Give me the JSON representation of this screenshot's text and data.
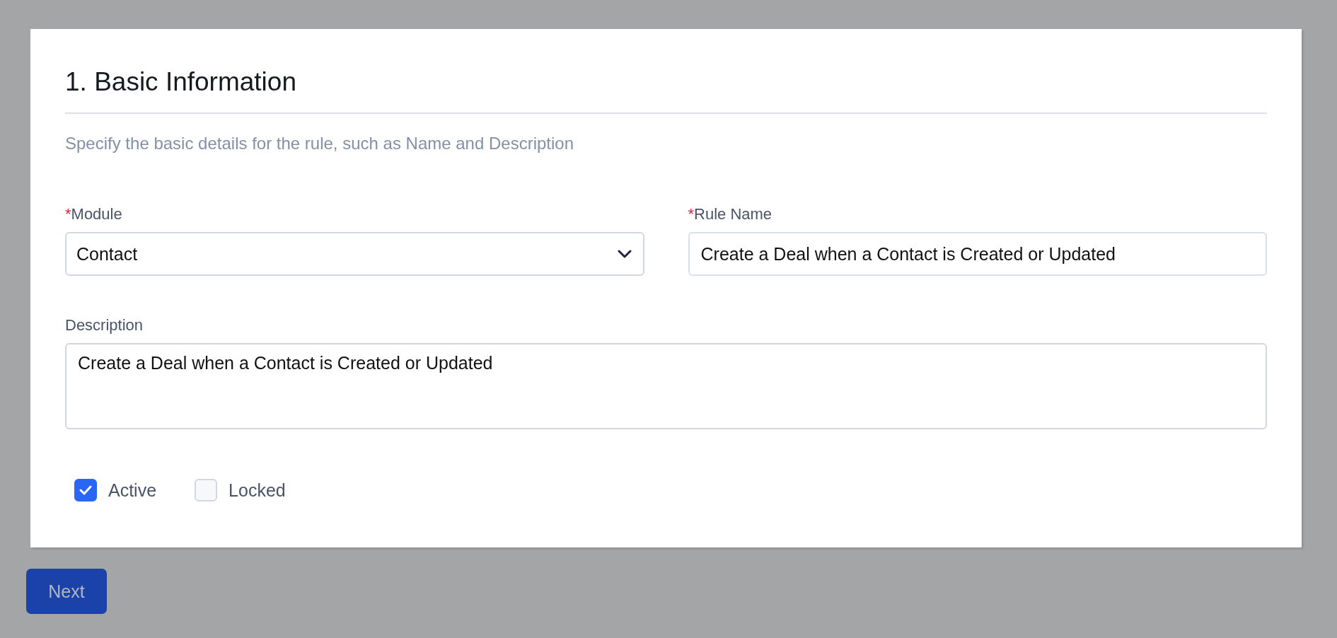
{
  "section": {
    "title": "1. Basic Information",
    "subtitle": "Specify the basic details for the rule, such as Name and Description"
  },
  "module": {
    "required_mark": "*",
    "label": "Module",
    "value": "Contact"
  },
  "rule_name": {
    "required_mark": "*",
    "label": "Rule Name",
    "value": "Create a Deal when a Contact is Created or Updated"
  },
  "description": {
    "label": "Description",
    "value": "Create a Deal when a Contact is Created or Updated"
  },
  "options": [
    {
      "label": "Active",
      "checked": true
    },
    {
      "label": "Locked",
      "checked": false
    }
  ],
  "next_button": {
    "label": "Next"
  }
}
